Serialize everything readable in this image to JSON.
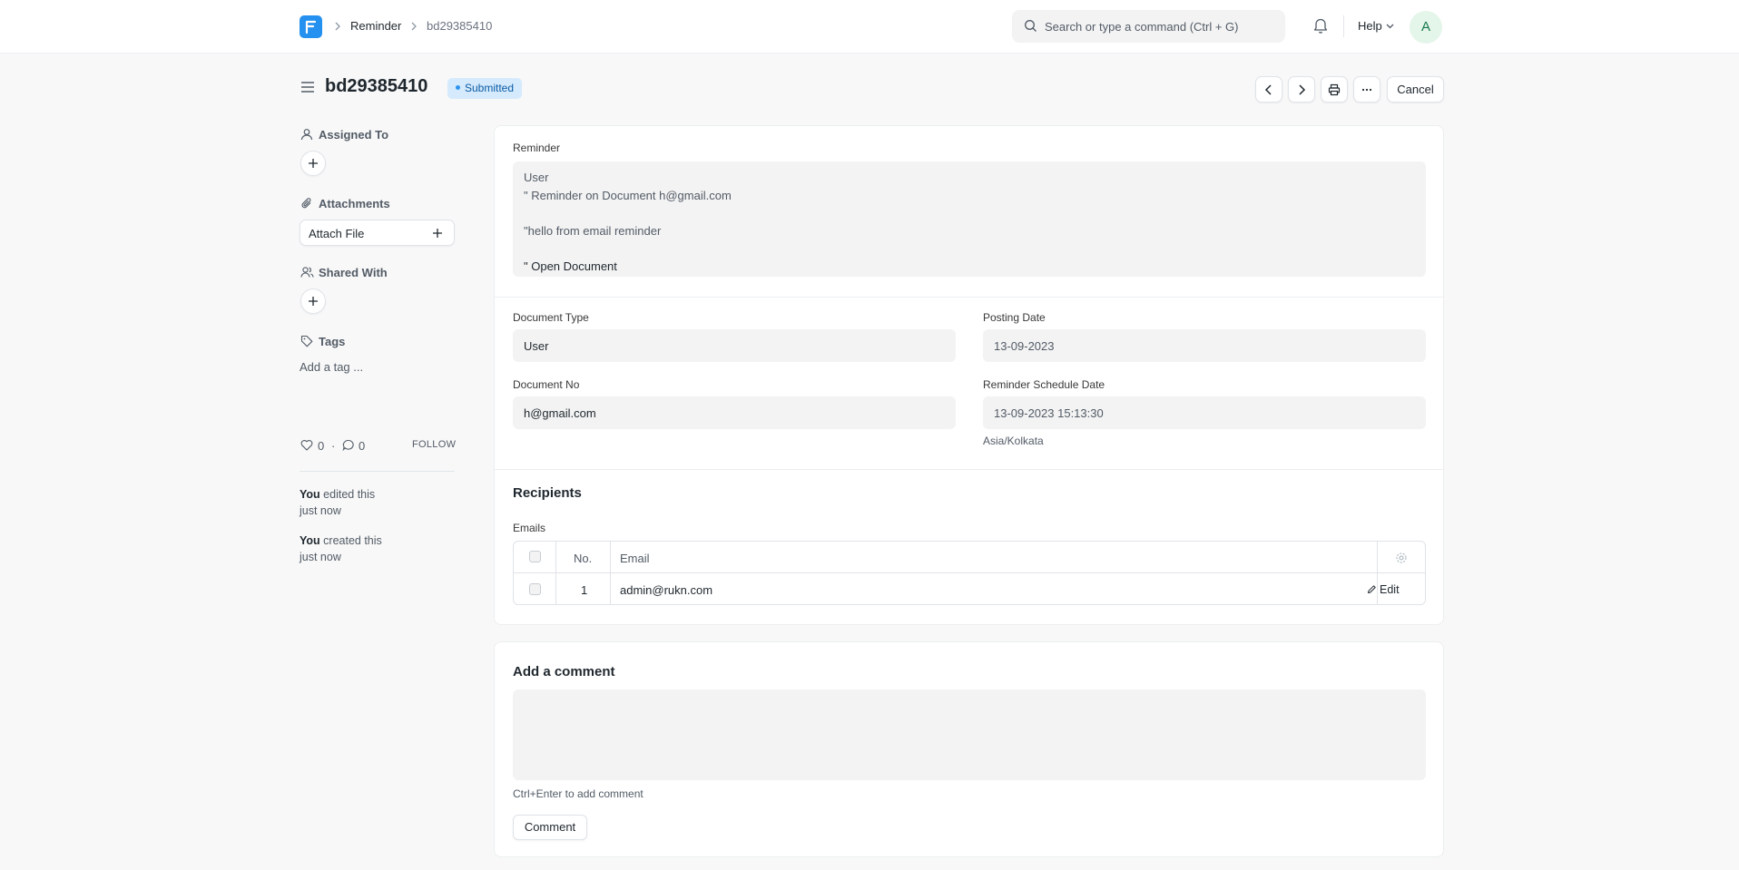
{
  "navbar": {
    "breadcrumbs": [
      "Reminder",
      "bd29385410"
    ],
    "search_placeholder": "Search or type a command (Ctrl + G)",
    "help_label": "Help",
    "avatar_initial": "A"
  },
  "page": {
    "title": "bd29385410",
    "status": "Submitted",
    "cancel_label": "Cancel"
  },
  "sidebar": {
    "assigned_to_label": "Assigned To",
    "attachments_label": "Attachments",
    "attach_file_label": "Attach File",
    "shared_with_label": "Shared With",
    "tags_label": "Tags",
    "add_tag_label": "Add a tag ...",
    "likes_count": "0",
    "comments_count": "0",
    "follow_label": "FOLLOW",
    "activity": [
      {
        "who": "You",
        "what": " edited this",
        "when": "just now"
      },
      {
        "who": "You",
        "what": " created this",
        "when": "just now"
      }
    ]
  },
  "form": {
    "reminder_label": "Reminder",
    "reminder_lines": [
      "User",
      "\" Reminder on Document h@gmail.com",
      "\"hello from email reminder",
      "\" Open Document"
    ],
    "document_type_label": "Document Type",
    "document_type_value": "User",
    "posting_date_label": "Posting Date",
    "posting_date_value": "13-09-2023",
    "document_no_label": "Document No",
    "document_no_value": "h@gmail.com",
    "schedule_date_label": "Reminder Schedule Date",
    "schedule_date_value": "13-09-2023 15:13:30",
    "timezone": "Asia/Kolkata",
    "recipients_title": "Recipients",
    "emails_label": "Emails",
    "grid_columns": {
      "no": "No.",
      "email": "Email"
    },
    "grid_rows": [
      {
        "no": "1",
        "email": "admin@rukn.com"
      }
    ],
    "edit_label": "Edit"
  },
  "comment": {
    "title": "Add a comment",
    "hint": "Ctrl+Enter to add comment",
    "button_label": "Comment"
  }
}
